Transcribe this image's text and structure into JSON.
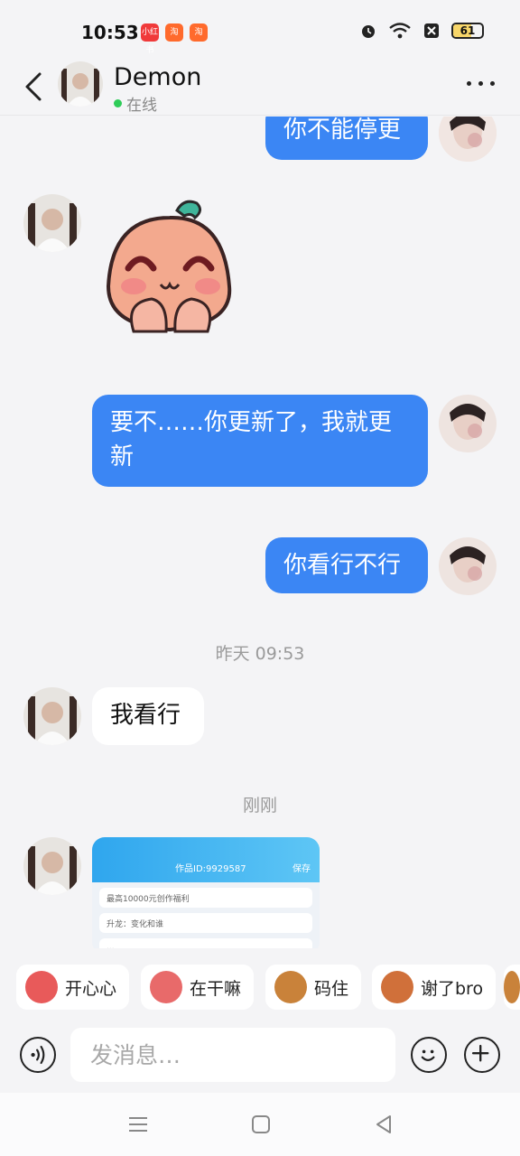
{
  "status_bar": {
    "time": "10:53",
    "app_icons": [
      "小红书",
      "淘",
      "淘"
    ],
    "battery": "61",
    "battery_level": 0.61
  },
  "header": {
    "name": "Demon",
    "status": "在线"
  },
  "messages": [
    {
      "side": "me",
      "text": "你不能停更"
    },
    {
      "side": "them",
      "type": "sticker"
    },
    {
      "side": "me",
      "text": "要不……你更新了，我就更新"
    },
    {
      "side": "me",
      "text": "你看行不行"
    },
    {
      "timestamp": "昨天 09:53"
    },
    {
      "side": "them",
      "text": "我看行"
    },
    {
      "timestamp": "刚刚"
    },
    {
      "side": "them",
      "type": "image"
    }
  ],
  "shared_image": {
    "title": "作品ID:9929587",
    "save": "保存",
    "rows": [
      "最高10000元创作福利",
      "升龙：变化和谁",
      "..."
    ]
  },
  "quick_replies": [
    {
      "label": "开心心",
      "color": "#e85a5a"
    },
    {
      "label": "在干嘛",
      "color": "#e86a6a"
    },
    {
      "label": "码住",
      "color": "#c9823a"
    },
    {
      "label": "谢了bro",
      "color": "#d0703a"
    }
  ],
  "input": {
    "placeholder": "发消息…"
  }
}
